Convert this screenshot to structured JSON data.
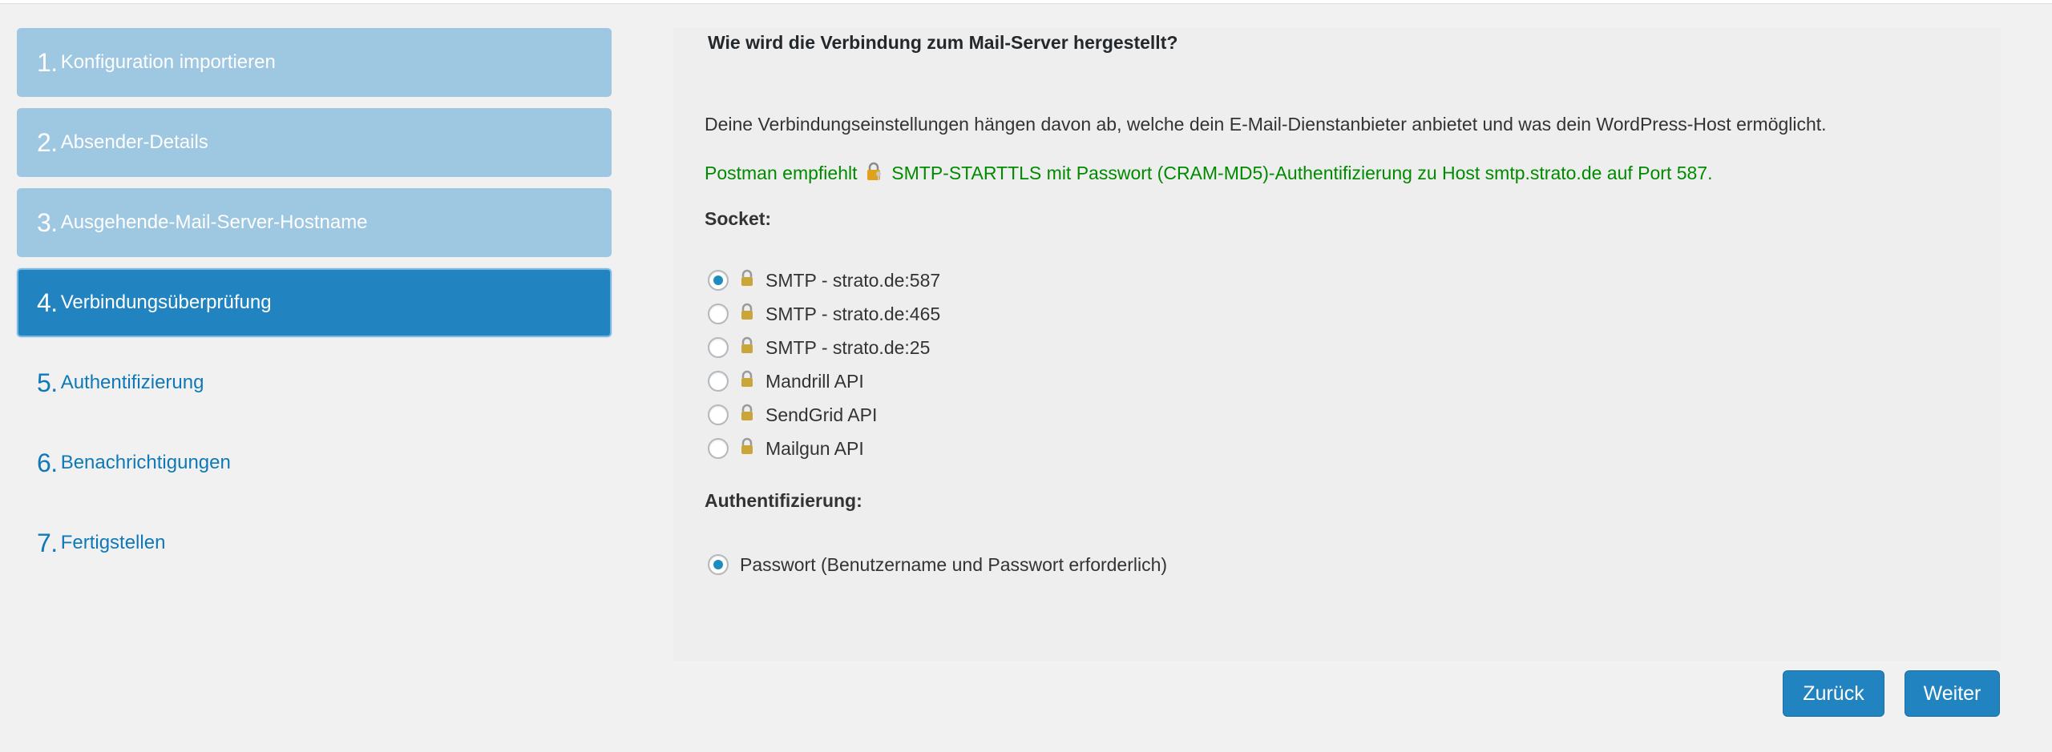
{
  "steps": [
    {
      "num": "1.",
      "label": "Konfiguration importieren",
      "state": "done"
    },
    {
      "num": "2.",
      "label": "Absender-Details",
      "state": "done"
    },
    {
      "num": "3.",
      "label": "Ausgehende-Mail-Server-Hostname",
      "state": "done"
    },
    {
      "num": "4.",
      "label": "Verbindungsüberprüfung",
      "state": "active"
    },
    {
      "num": "5.",
      "label": "Authentifizierung",
      "state": "pending"
    },
    {
      "num": "6.",
      "label": "Benachrichtigungen",
      "state": "pending"
    },
    {
      "num": "7.",
      "label": "Fertigstellen",
      "state": "pending"
    }
  ],
  "main": {
    "title": "Wie wird die Verbindung zum Mail-Server hergestellt?",
    "description": "Deine Verbindungseinstellungen hängen davon ab, welche dein E-Mail-Dienstanbieter anbietet und was dein WordPress-Host ermöglicht.",
    "recommend_prefix": "Postman empfiehlt",
    "recommend_suffix": "SMTP-STARTTLS mit Passwort (CRAM-MD5)-Authentifizierung zu Host smtp.strato.de auf Port 587.",
    "socket_label": "Socket:",
    "socket_options": [
      {
        "label": "SMTP - strato.de:587",
        "checked": true
      },
      {
        "label": "SMTP - strato.de:465",
        "checked": false
      },
      {
        "label": "SMTP - strato.de:25",
        "checked": false
      },
      {
        "label": "Mandrill API",
        "checked": false
      },
      {
        "label": "SendGrid API",
        "checked": false
      },
      {
        "label": "Mailgun API",
        "checked": false
      }
    ],
    "auth_label": "Authentifizierung:",
    "auth_option": {
      "label": "Passwort (Benutzername und Passwort erforderlich)",
      "checked": true
    }
  },
  "buttons": {
    "back": "Zurück",
    "next": "Weiter"
  },
  "colors": {
    "accent": "#2283c1",
    "done_step": "#9ec7e2",
    "success_text": "#008a00",
    "link": "#0f79b8"
  },
  "icons": {
    "lock": "lock-icon",
    "lock_key": "lock-key-icon"
  }
}
